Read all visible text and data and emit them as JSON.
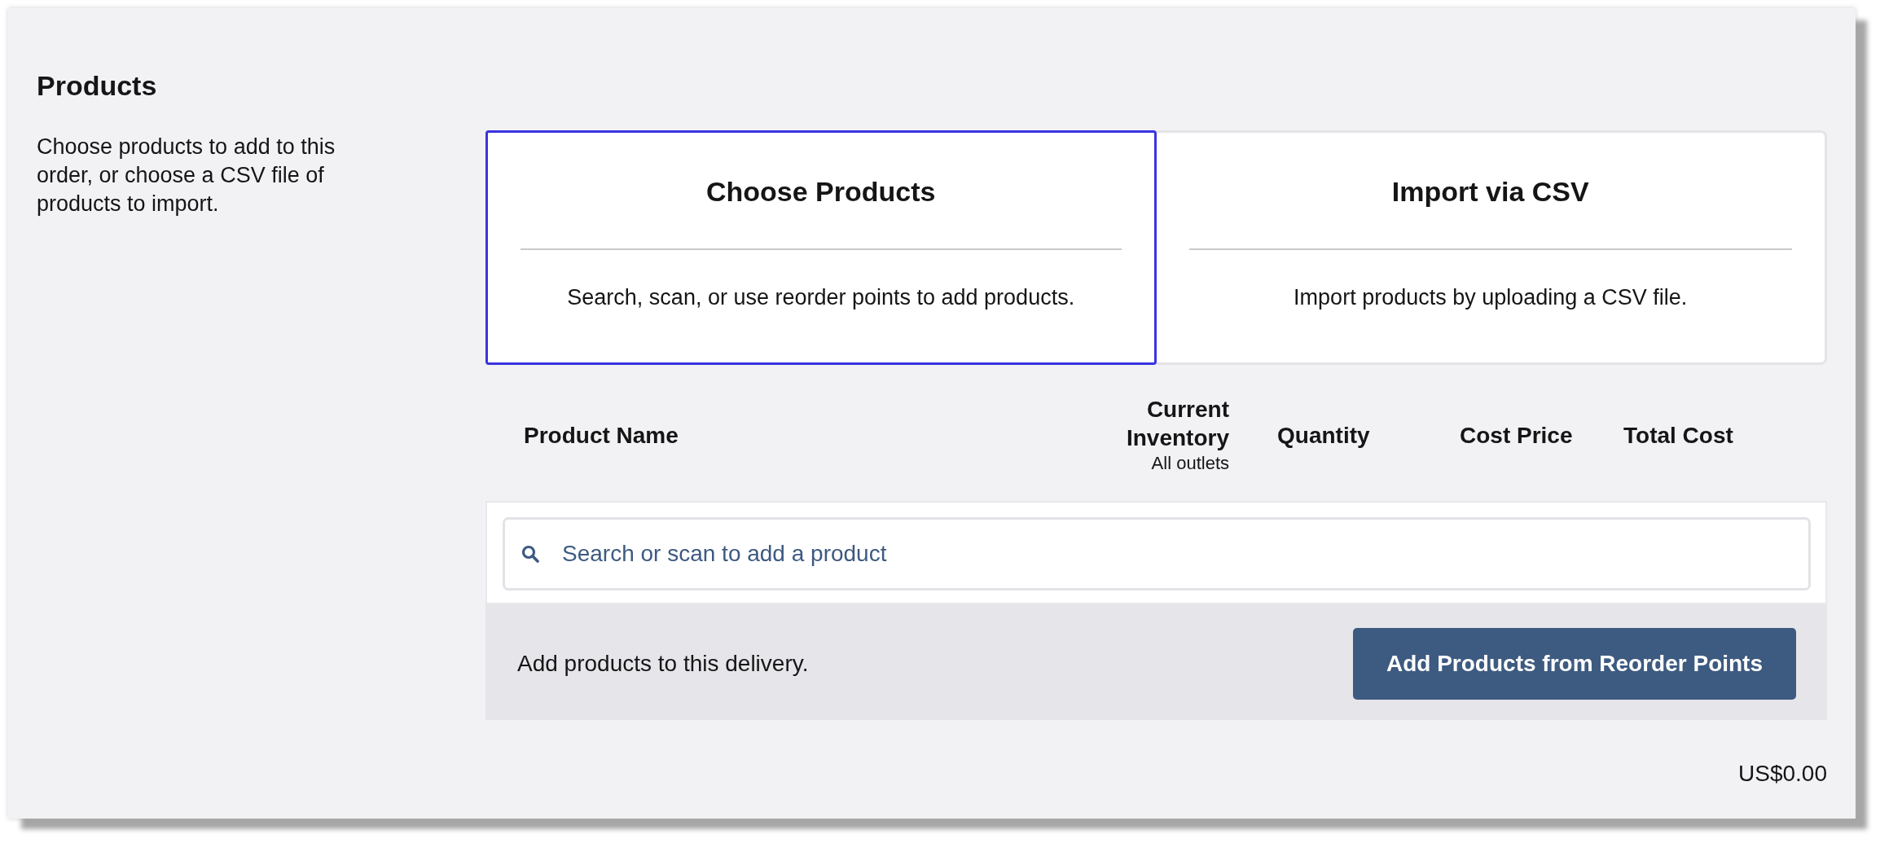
{
  "section": {
    "title": "Products",
    "description": "Choose products to add to this order, or choose a CSV file of products to import."
  },
  "tabs": [
    {
      "title": "Choose Products",
      "description": "Search, scan, or use reorder points to add products.",
      "selected": true
    },
    {
      "title": "Import via CSV",
      "description": "Import products by uploading a CSV file.",
      "selected": false
    }
  ],
  "table": {
    "columns": [
      {
        "label": "Product Name"
      },
      {
        "label": "Current Inventory",
        "sublabel": "All outlets"
      },
      {
        "label": "Quantity"
      },
      {
        "label": "Cost Price"
      },
      {
        "label": "Total Cost"
      }
    ]
  },
  "search": {
    "placeholder": "Search or scan to add a product"
  },
  "footer": {
    "text": "Add products to this delivery.",
    "button": "Add Products from Reorder Points"
  },
  "total": "US$0.00"
}
